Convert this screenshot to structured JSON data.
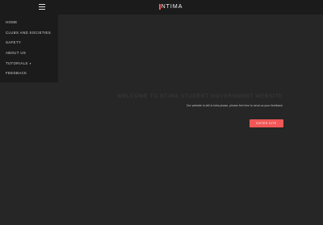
{
  "header": {
    "menu_icon": "hamburger-icon",
    "logo_text": "NTIMA",
    "logo_accent_color": "#f25a5a"
  },
  "sidebar": {
    "items": [
      {
        "label": "HOME"
      },
      {
        "label": "CLUBS AND SOCIETIES"
      },
      {
        "label": "SAFETY"
      },
      {
        "label": "ABOUT US"
      },
      {
        "label": "TUTORIALS",
        "caret": "▾"
      },
      {
        "label": "FEEDBACK"
      }
    ]
  },
  "hero": {
    "title": "WELCOME TO NTIMA STUDENT GOVERNMENT WEBSITE",
    "subtitle": "Our website is still in beta phase, please feel free to send us your feedback",
    "button_label": "ENTER SITE",
    "button_color": "#f25656"
  }
}
